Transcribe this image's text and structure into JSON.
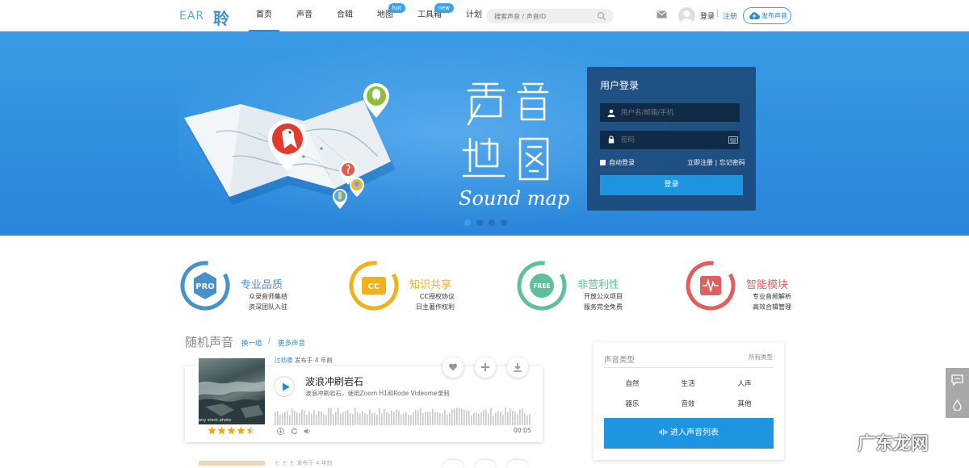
{
  "header": {
    "logo_text": "EAR",
    "logo_char": "聆",
    "nav": [
      {
        "label": "首页",
        "badge": ""
      },
      {
        "label": "声音",
        "badge": ""
      },
      {
        "label": "合辑",
        "badge": ""
      },
      {
        "label": "地图",
        "badge": "hot"
      },
      {
        "label": "工具箱",
        "badge": "new"
      },
      {
        "label": "计划",
        "badge": ""
      }
    ],
    "search_placeholder": "搜索声音 / 声音ID",
    "login": "登录",
    "separator": "|",
    "register": "注册",
    "publish": "发布声音"
  },
  "banner": {
    "title_chars": [
      "声",
      "音",
      "地",
      "图"
    ],
    "subtitle": "Sound map",
    "slides": 4,
    "active_slide": 0
  },
  "login": {
    "title": "用户登录",
    "username_placeholder": "用户名/邮箱/手机",
    "password_placeholder": "密码",
    "auto_login": "自动登录",
    "register_now": "立即注册",
    "links_sep": "|",
    "forgot": "忘记密码",
    "submit": "登录"
  },
  "features": [
    {
      "badge": "PRO",
      "title": "专业品质",
      "line1": "众录音师集结",
      "line2": "资深团队入驻",
      "color": "#4b90c8"
    },
    {
      "badge": "CC",
      "title": "知识共享",
      "line1": "CC授权协议",
      "line2": "日主著作权利",
      "color": "#f0b11c"
    },
    {
      "badge": "FREE",
      "title": "非营利性",
      "line1": "开放公众项目",
      "line2": "服务完全免费",
      "color": "#5fbf9b"
    },
    {
      "badge": "",
      "title": "智能模块",
      "line1": "专业音频解析",
      "line2": "高效合辑管理",
      "color": "#e25e5e"
    }
  ],
  "random": {
    "title": "随机声音",
    "shuffle": "换一组",
    "sep": "/",
    "more": "更多声音"
  },
  "sound": {
    "author": "过劲骤",
    "posted": " 发布于 4 年前",
    "title": "波浪冲刷岩石",
    "desc": "波浪冲刷岩石，使用Zoom H1和Rode Videome录制",
    "duration": "00:05",
    "rating": 4.5,
    "thumb_caption": "any stock photo",
    "next_meta": "ヒ ヒ ヒ 发布于 4 年前"
  },
  "types": {
    "title": "声音类型",
    "all": "所有类型",
    "items": [
      "自然",
      "生活",
      "人声",
      "器乐",
      "音效",
      "其他"
    ],
    "button": "进入声音列表"
  },
  "watermark": "广东龙网",
  "colors": {
    "accent": "#2a8ad6",
    "button": "#1d95e0"
  }
}
